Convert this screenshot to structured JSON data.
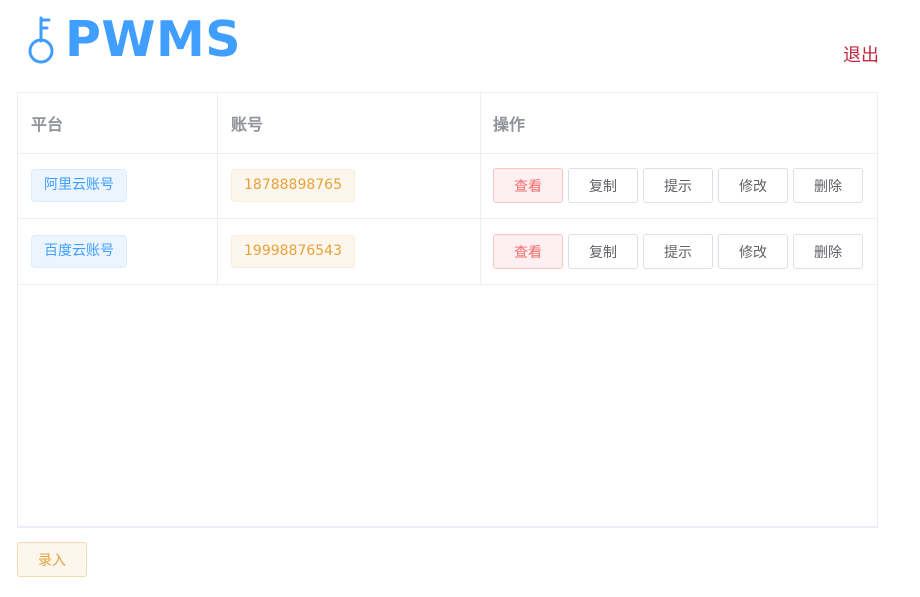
{
  "app": {
    "title": "PWMS",
    "logo_icon": "key-icon",
    "logout_label": "退出",
    "accent_color": "#409eff"
  },
  "table": {
    "headers": [
      "平台",
      "账号",
      "操作"
    ],
    "rows": [
      {
        "platform": "阿里云账号",
        "account": "18788898765"
      },
      {
        "platform": "百度云账号",
        "account": "19998876543"
      }
    ],
    "actions": [
      "查看",
      "复制",
      "提示",
      "修改",
      "删除"
    ]
  },
  "footer": {
    "add_label": "录入"
  }
}
